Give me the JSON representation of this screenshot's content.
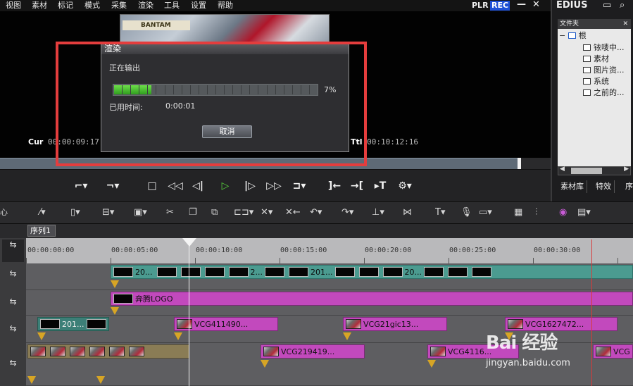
{
  "menu": [
    "视图",
    "素材",
    "标记",
    "模式",
    "采集",
    "渲染",
    "工具",
    "设置",
    "帮助"
  ],
  "player": {
    "plr": "PLR",
    "rec": "REC",
    "minimize": "—",
    "close": "✕",
    "thumb_sign": "BANTAM",
    "cur_label": "Cur",
    "cur_value": "00:00:09:17",
    "ttl_label": "Ttl",
    "ttl_value": "00:10:12:16",
    "scrub_progress_percent": 99
  },
  "dialog": {
    "title": "渲染",
    "status": "正在输出",
    "progress_percent": 7,
    "progress_text": "7%",
    "elapsed_label": "已用时间:",
    "elapsed_value": "0:00:01",
    "cancel": "取消"
  },
  "right_panel": {
    "brand": "EDIUS",
    "folder_header": "文件夹",
    "header_close": "✕",
    "root": "根",
    "folders": [
      "铱唛中...",
      "素材",
      "图片资...",
      "系统",
      "之前的..."
    ],
    "tabs": [
      "素材库",
      "特效",
      "序"
    ]
  },
  "left_panel_label": "心",
  "sequence_tab": "序列1",
  "ruler_labels": [
    "00:00:00:00",
    "00:00:05:00",
    "00:00:10:00",
    "00:00:15:00",
    "00:00:20:00",
    "00:00:25:00",
    "00:00:30:00"
  ],
  "tracks": {
    "row1_clips": [
      "20...",
      "2...",
      "201...",
      "20..."
    ],
    "row2_clip": "奔腾LOGO",
    "row3_clips": [
      "201...",
      "VCG411490...",
      "VCG21gic13...",
      "VCG1627472..."
    ],
    "row4_clips": [
      "VCG219419...",
      "VCG4116...",
      "VCG"
    ]
  },
  "watermark": {
    "text": "Bai 经验",
    "url": "jingyan.baidu.com"
  },
  "colors": {
    "accent_red": "#e43d3d",
    "progress_green": "#4bc534",
    "clip_teal": "#4b9b90",
    "clip_pink": "#c249bd",
    "rec_blue": "#1d4fd6"
  },
  "icons": {
    "transport": [
      "mark-in-icon",
      "mark-out-icon",
      "stop-icon",
      "rewind-icon",
      "step-back-icon",
      "play-icon",
      "step-forward-icon",
      "fast-forward-icon",
      "loop-icon",
      "jump-in-icon",
      "jump-out-icon",
      "set-in-out-icon",
      "settings-icon"
    ]
  }
}
